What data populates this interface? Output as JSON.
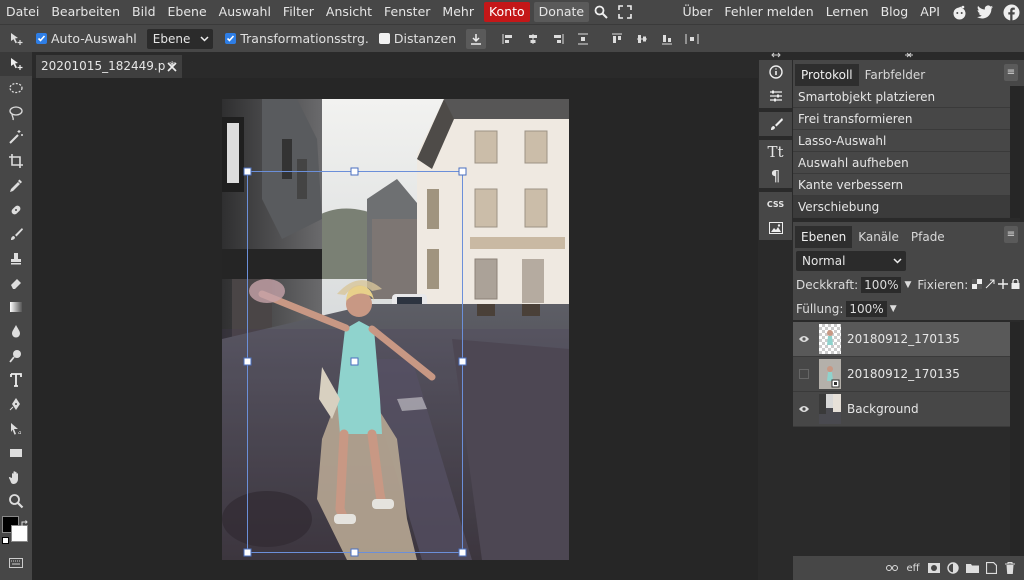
{
  "menu": {
    "items": [
      "Datei",
      "Bearbeiten",
      "Bild",
      "Ebene",
      "Auswahl",
      "Filter",
      "Ansicht",
      "Fenster",
      "Mehr"
    ],
    "konto": "Konto",
    "donate": "Donate",
    "right_links": [
      "Über",
      "Fehler melden",
      "Lernen",
      "Blog",
      "API"
    ]
  },
  "options": {
    "auto_select": "Auto-Auswahl",
    "auto_select_checked": true,
    "target_value": "Ebene",
    "transform": "Transformationsstrg.",
    "transform_checked": true,
    "distances": "Distanzen",
    "distances_checked": false
  },
  "document": {
    "tab_title": "20201015_182449.p *"
  },
  "history": {
    "tabs": [
      "Protokoll",
      "Farbfelder"
    ],
    "items": [
      "Smartobjekt platzieren",
      "Frei transformieren",
      "Lasso-Auswahl",
      "Auswahl aufheben",
      "Kante verbessern",
      "Verschiebung"
    ]
  },
  "layers": {
    "tabs": [
      "Ebenen",
      "Kanäle",
      "Pfade"
    ],
    "blend_mode": "Normal",
    "opacity_label": "Deckkraft:",
    "opacity_value": "100%",
    "lock_label": "Fixieren:",
    "fill_label": "Füllung:",
    "fill_value": "100%",
    "items": [
      {
        "name": "20180912_170135",
        "visible": true,
        "selected": true
      },
      {
        "name": "20180912_170135",
        "visible": false,
        "selected": false
      },
      {
        "name": "Background",
        "visible": true,
        "selected": false
      }
    ],
    "bottom_eff": "eff"
  },
  "midcol": {
    "css_label": "CSS"
  },
  "colors": {
    "accent": "#2e7ee6",
    "konto": "#c41718",
    "panel": "#474747",
    "workspace": "#262626"
  }
}
